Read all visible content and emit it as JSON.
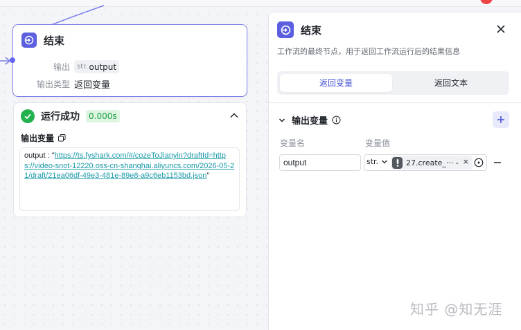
{
  "node": {
    "title": "结束",
    "output_label": "输出",
    "output_type_tag": "str.",
    "output_name": "output",
    "output_type_label": "输出类型",
    "output_type_value": "返回变量"
  },
  "run": {
    "status": "运行成功",
    "duration": "0.000s",
    "output_var_label": "输出变量",
    "output_key": "output : \"",
    "output_link": "https://ts.fyshark.com/#/cozeToJianyin?draftId=https://video-snot-12220.oss-cn-shanghai.aliyuncs.com/2026-05-21/draft/21ea06df-49e3-481e-89e8-a9c6eb1153bd.json",
    "output_tail": "\""
  },
  "panel": {
    "title": "结束",
    "description": "工作流的最终节点，用于返回工作流运行后的结果信息",
    "tabs": [
      {
        "label": "返回变量",
        "active": true
      },
      {
        "label": "返回文本",
        "active": false
      }
    ],
    "section_title": "输出变量",
    "col_name": "变量名",
    "col_value": "变量值",
    "row": {
      "name": "output",
      "type": "str.",
      "ref": "27.create_··· - ",
      "ref_clear": "×"
    }
  },
  "watermark": "知乎 @知无涯",
  "colors": {
    "accent": "#5b5fe0",
    "success": "#22b14c",
    "link": "#1a9aa8",
    "danger": "#ef4444"
  }
}
